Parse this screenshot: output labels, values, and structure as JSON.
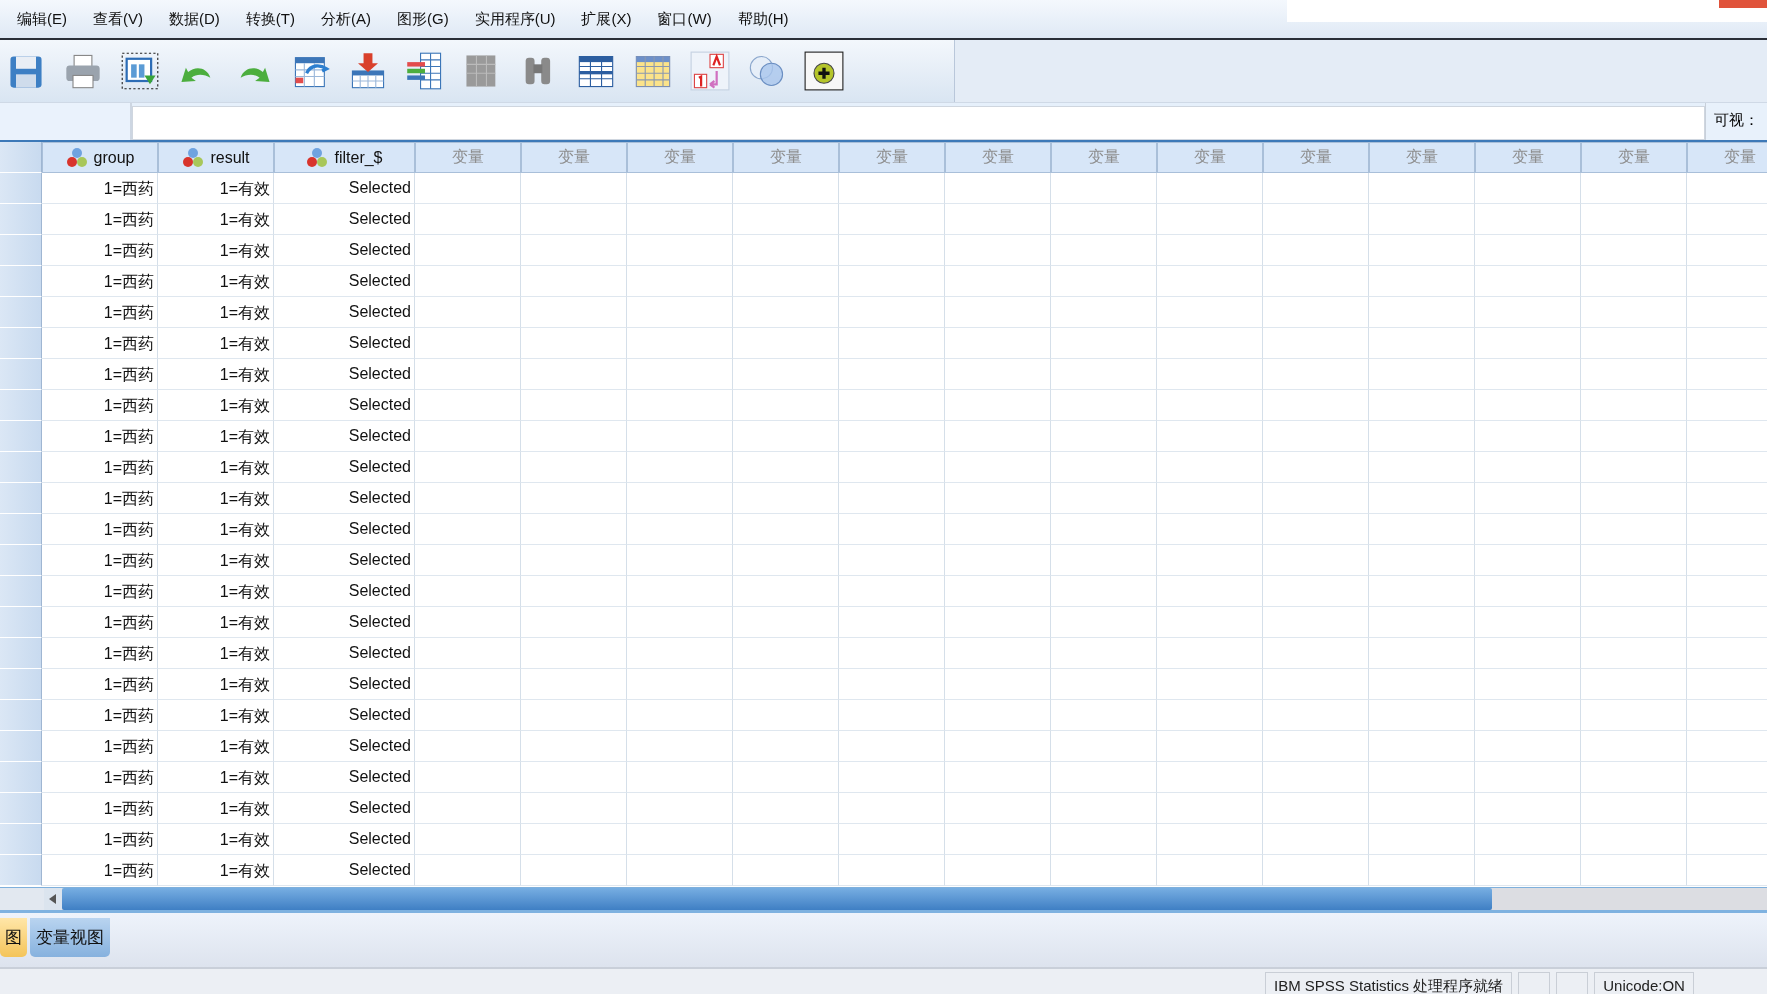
{
  "menu": [
    "编辑(E)",
    "查看(V)",
    "数据(D)",
    "转换(T)",
    "分析(A)",
    "图形(G)",
    "实用程序(U)",
    "扩展(X)",
    "窗口(W)",
    "帮助(H)"
  ],
  "cell_editor": {
    "visible_label": "可视："
  },
  "table": {
    "columns": [
      {
        "name": "group",
        "kind": "variable"
      },
      {
        "name": "result",
        "kind": "variable"
      },
      {
        "name": "filter_$",
        "kind": "variable"
      },
      {
        "name": "变量",
        "kind": "empty"
      },
      {
        "name": "变量",
        "kind": "empty"
      },
      {
        "name": "变量",
        "kind": "empty"
      },
      {
        "name": "变量",
        "kind": "empty"
      },
      {
        "name": "变量",
        "kind": "empty"
      },
      {
        "name": "变量",
        "kind": "empty"
      },
      {
        "name": "变量",
        "kind": "empty"
      },
      {
        "name": "变量",
        "kind": "empty"
      },
      {
        "name": "变量",
        "kind": "empty"
      },
      {
        "name": "变量",
        "kind": "empty"
      },
      {
        "name": "变量",
        "kind": "empty"
      },
      {
        "name": "变量",
        "kind": "empty"
      },
      {
        "name": "变量",
        "kind": "empty"
      }
    ],
    "rows": [
      {
        "cells": [
          "1=西药",
          "1=有效",
          "Selected"
        ]
      },
      {
        "cells": [
          "1=西药",
          "1=有效",
          "Selected"
        ]
      },
      {
        "cells": [
          "1=西药",
          "1=有效",
          "Selected"
        ]
      },
      {
        "cells": [
          "1=西药",
          "1=有效",
          "Selected"
        ]
      },
      {
        "cells": [
          "1=西药",
          "1=有效",
          "Selected"
        ]
      },
      {
        "cells": [
          "1=西药",
          "1=有效",
          "Selected"
        ]
      },
      {
        "cells": [
          "1=西药",
          "1=有效",
          "Selected"
        ]
      },
      {
        "cells": [
          "1=西药",
          "1=有效",
          "Selected"
        ]
      },
      {
        "cells": [
          "1=西药",
          "1=有效",
          "Selected"
        ]
      },
      {
        "cells": [
          "1=西药",
          "1=有效",
          "Selected"
        ]
      },
      {
        "cells": [
          "1=西药",
          "1=有效",
          "Selected"
        ]
      },
      {
        "cells": [
          "1=西药",
          "1=有效",
          "Selected"
        ]
      },
      {
        "cells": [
          "1=西药",
          "1=有效",
          "Selected"
        ]
      },
      {
        "cells": [
          "1=西药",
          "1=有效",
          "Selected"
        ]
      },
      {
        "cells": [
          "1=西药",
          "1=有效",
          "Selected"
        ]
      },
      {
        "cells": [
          "1=西药",
          "1=有效",
          "Selected"
        ]
      },
      {
        "cells": [
          "1=西药",
          "1=有效",
          "Selected"
        ]
      },
      {
        "cells": [
          "1=西药",
          "1=有效",
          "Selected"
        ]
      },
      {
        "cells": [
          "1=西药",
          "1=有效",
          "Selected"
        ]
      },
      {
        "cells": [
          "1=西药",
          "1=有效",
          "Selected"
        ]
      },
      {
        "cells": [
          "1=西药",
          "1=有效",
          "Selected"
        ]
      },
      {
        "cells": [
          "1=西药",
          "1=有效",
          "Selected"
        ]
      },
      {
        "cells": [
          "1=西药",
          "1=有效",
          "Selected"
        ]
      }
    ]
  },
  "view_tabs": [
    {
      "label": "图",
      "selected": true
    },
    {
      "label": "变量视图",
      "selected": false
    }
  ],
  "status_bar": {
    "fields": [
      "IBM SPSS Statistics 处理程序就绪",
      "Unicode:ON"
    ]
  }
}
